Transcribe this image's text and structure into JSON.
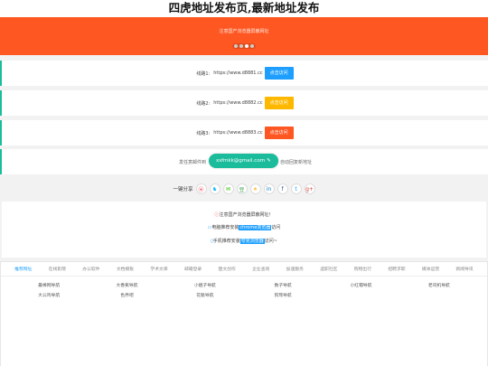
{
  "page_title": "四虎地址发布页,最新地址发布",
  "banner": {
    "notice": "注意国产浏览器屏蔽网址",
    "dot_count": 4,
    "active_dot": 2
  },
  "lines": [
    {
      "label": "线路1:",
      "url": "https://www.d8881.cc",
      "button": "点击访问",
      "color": "blue"
    },
    {
      "label": "线路2:",
      "url": "https://www.d8882.cc",
      "button": "点击访问",
      "color": "yellow"
    },
    {
      "label": "线路3:",
      "url": "https://www.d8883.cc",
      "button": "点击访问",
      "color": "red"
    }
  ],
  "mail": {
    "left_text": "发任意邮件到",
    "email": "xsfmkk@gmail.com",
    "right_text": "自动回复新地址"
  },
  "share": {
    "label": "一键分享",
    "icons": [
      "weibo-icon",
      "qq-icon",
      "wechat-icon",
      "douban-icon",
      "qzone-icon",
      "linkedin-icon",
      "facebook-icon",
      "twitter-icon",
      "googleplus-icon"
    ]
  },
  "notice": {
    "line1": "注意国产浏览器屏蔽网址！",
    "line2_pre": "电脑推荐安装",
    "line2_hl": "chrome浏览器",
    "line2_post": "访问",
    "line3_pre": "手机推荐安装",
    "line3_hl": "夸克浏览器",
    "line3_post": "访问~"
  },
  "nav": {
    "tabs": [
      "推荐网址",
      "在线影院",
      "办公软件",
      "文档模板",
      "学术文库",
      "邮箱登录",
      "图文创作",
      "企业查询",
      "加速服务",
      "选职社区",
      "购物出行",
      "招聘求职",
      "媒体运营",
      "新闻导讯"
    ],
    "active_tab": 0,
    "links": [
      "最棒网导航",
      "大香蕉导航",
      "小姐子导航",
      "数子导航",
      "小红帽导航",
      "老司机导航",
      "大公鸡导航",
      "色界吧",
      "花魁导航",
      "狗熊导航"
    ]
  }
}
